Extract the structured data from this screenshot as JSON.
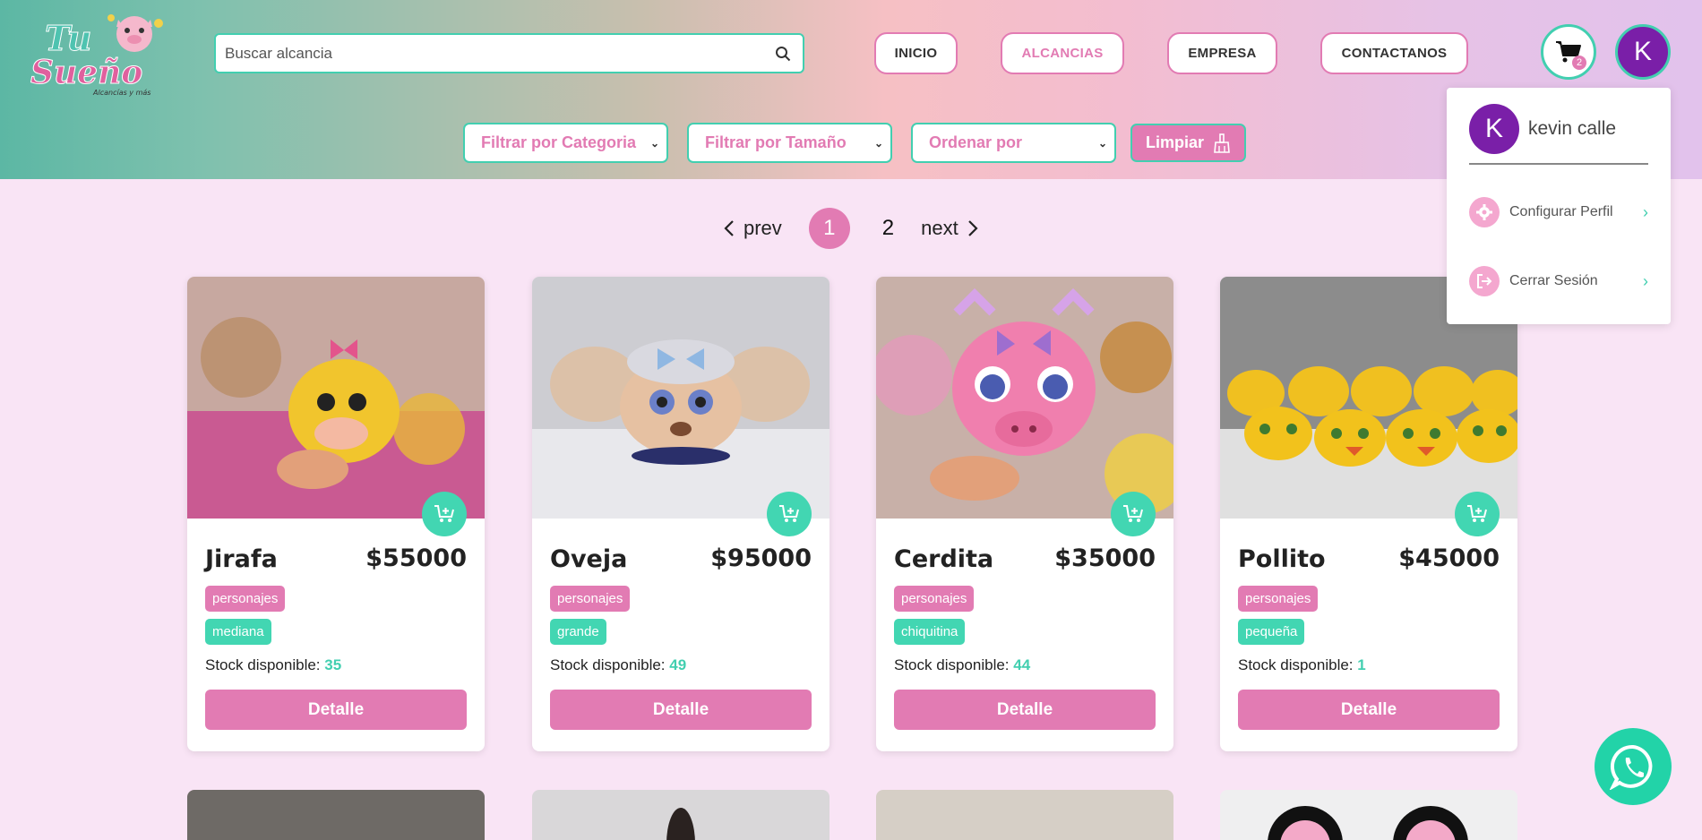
{
  "header": {
    "logo_text": "Tu Sueño",
    "logo_subtext": "Alcancías y más",
    "search_placeholder": "Buscar alcancia",
    "nav": [
      "INICIO",
      "ALCANCIAS",
      "EMPRESA",
      "CONTACTANOS"
    ],
    "active_nav": "ALCANCIAS",
    "cart_count": "2",
    "avatar_initial": "K"
  },
  "filters": {
    "category": "Filtrar por Categoria",
    "size": "Filtrar por Tamaño",
    "order": "Ordenar por",
    "clear": "Limpiar"
  },
  "pagination": {
    "prev": "prev",
    "next": "next",
    "current": "1",
    "page2": "2"
  },
  "products": [
    {
      "name": "Jirafa",
      "price": "$55000",
      "category": "personajes",
      "size": "mediana",
      "stock_label": "Stock disponible:",
      "stock": "35",
      "button": "Detalle",
      "color": "#e8c13a"
    },
    {
      "name": "Oveja",
      "price": "$95000",
      "category": "personajes",
      "size": "grande",
      "stock_label": "Stock disponible:",
      "stock": "49",
      "button": "Detalle",
      "color": "#d8b08a"
    },
    {
      "name": "Cerdita",
      "price": "$35000",
      "category": "personajes",
      "size": "chiquitina",
      "stock_label": "Stock disponible:",
      "stock": "44",
      "button": "Detalle",
      "color": "#ee7fa8"
    },
    {
      "name": "Pollito",
      "price": "$45000",
      "category": "personajes",
      "size": "pequeña",
      "stock_label": "Stock disponible:",
      "stock": "1",
      "button": "Detalle",
      "color": "#f0c020"
    }
  ],
  "profile_menu": {
    "initial": "K",
    "name": "kevin calle",
    "items": [
      {
        "label": "Configurar Perfil",
        "icon": "gear-icon"
      },
      {
        "label": "Cerrar Sesión",
        "icon": "logout-icon"
      }
    ]
  },
  "colors": {
    "pink": "#e27bb3",
    "teal": "#42cfb0",
    "purple": "#7a1fa8",
    "whatsapp": "#22d3a8"
  }
}
